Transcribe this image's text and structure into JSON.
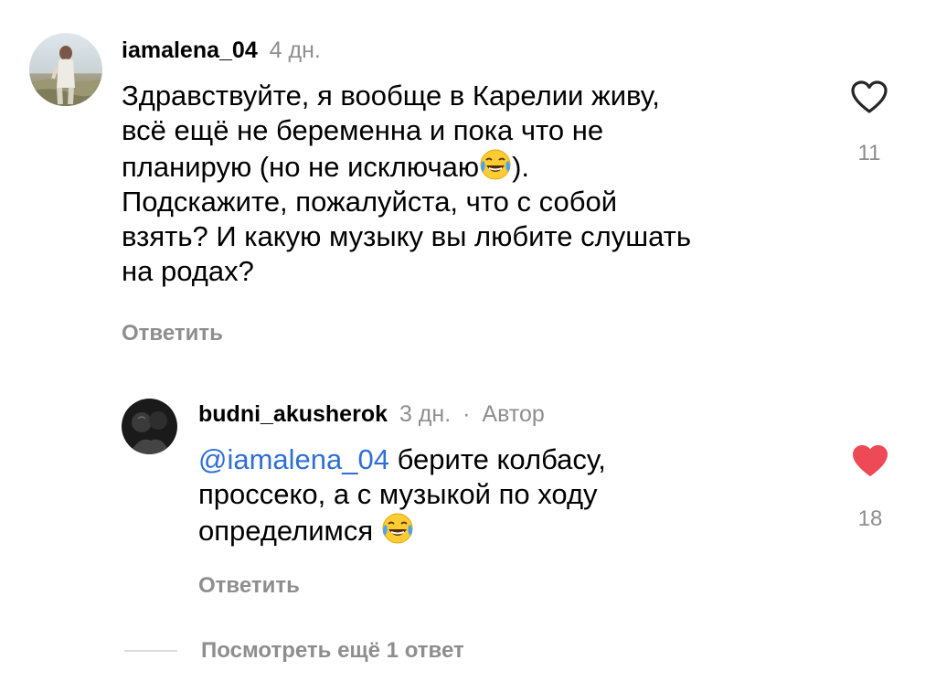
{
  "comments": [
    {
      "username": "iamalena_04",
      "time": "4 дн.",
      "text_lines": [
        "Здравствуйте, я вообще в Карелии живу,",
        "всё ещё не беременна и пока что не",
        "планирую (но не исключаю",
        ").",
        "Подскажите, пожалуйста, что с собой",
        "взять? И какую музыку вы любите слушать",
        "на родах?"
      ],
      "reply_label": "Ответить",
      "like_count": "11",
      "liked": false,
      "avatar_icon": "avatar-photo-beach",
      "emoji_icon": "face-with-tears-of-joy"
    },
    {
      "username": "budni_akusherok",
      "time": "3 дн.",
      "separator": "·",
      "author_tag": "Автор",
      "mention": "@iamalena_04",
      "text_lines": [
        " берите колбасу,",
        "проссеко, а с музыкой по ходу",
        "определимся "
      ],
      "reply_label": "Ответить",
      "like_count": "18",
      "liked": true,
      "avatar_icon": "avatar-photo-dark",
      "emoji_icon": "face-with-tears-of-joy"
    }
  ],
  "more_replies_label": "Посмотреть ещё 1 ответ",
  "colors": {
    "text": "#000000",
    "secondary": "#8e8e8e",
    "mention": "#2f6fd6",
    "like_red": "#ed4956",
    "divider": "#dbdbdb"
  }
}
